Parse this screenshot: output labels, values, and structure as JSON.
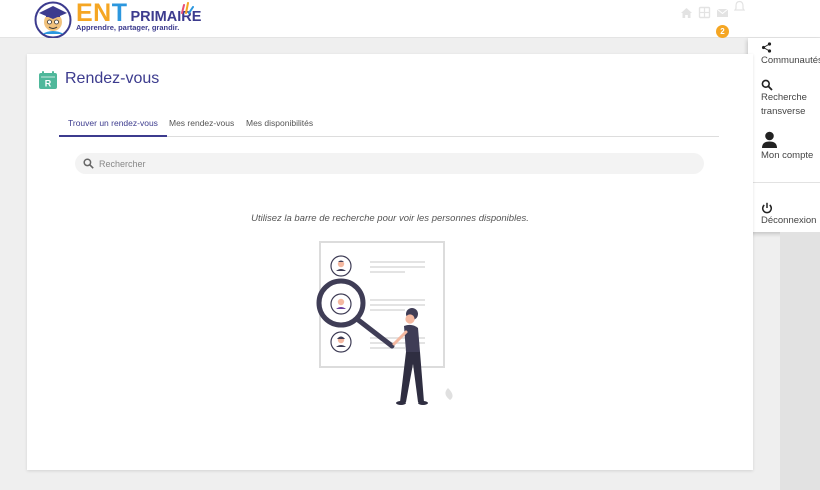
{
  "app": {
    "logo_main": "ENT",
    "logo_secondary": "PRIMAIRE",
    "logo_tagline": "Apprendre, partager, grandir."
  },
  "header": {
    "notification_count": "2",
    "icons": [
      "home-icon",
      "apps-icon",
      "mail-icon",
      "bell-icon"
    ]
  },
  "sidebar": {
    "items": [
      {
        "label": "Communautés",
        "icon": "share-icon"
      },
      {
        "label": "Recherche transverse",
        "icon": "search-icon"
      },
      {
        "label": "Mon compte",
        "icon": "user-icon"
      },
      {
        "label": "Déconnexion",
        "icon": "power-icon"
      }
    ]
  },
  "page": {
    "title": "Rendez-vous",
    "tabs": [
      {
        "label": "Trouver un rendez-vous",
        "active": true
      },
      {
        "label": "Mes rendez-vous",
        "active": false
      },
      {
        "label": "Mes disponibilités",
        "active": false
      }
    ],
    "search": {
      "placeholder": "Rechercher",
      "value": ""
    },
    "hint": "Utilisez la barre de recherche pour voir les personnes disponibles."
  },
  "colors": {
    "primary": "#3c3b8e",
    "accent": "#f5a623",
    "title_icon": "#4fb89b",
    "illustration_accent": "#6c3fa0"
  }
}
